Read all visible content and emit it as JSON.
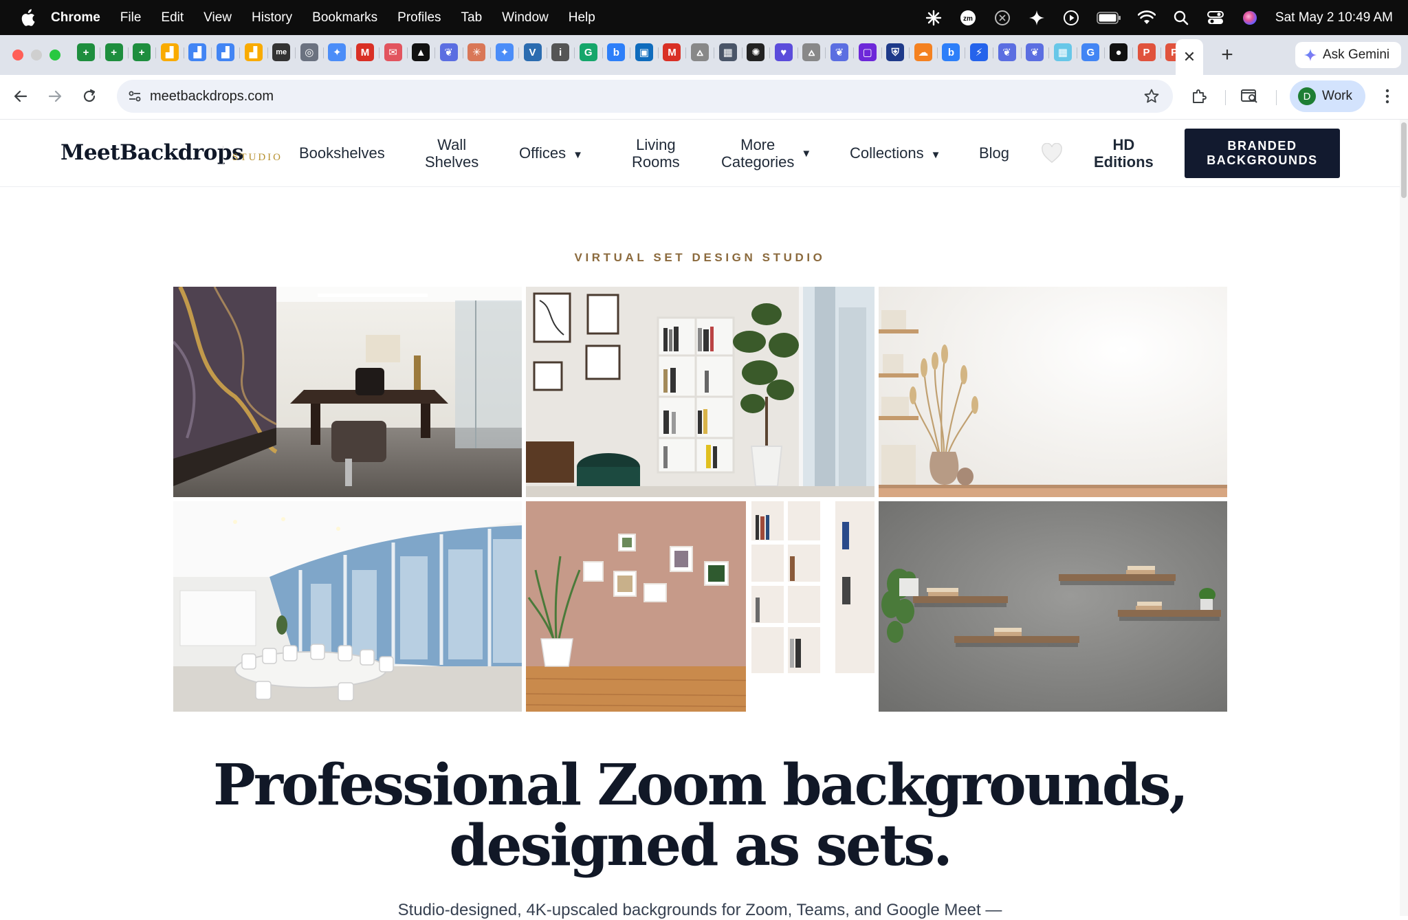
{
  "menubar": {
    "items": [
      "Chrome",
      "File",
      "Edit",
      "View",
      "History",
      "Bookmarks",
      "Profiles",
      "Tab",
      "Window",
      "Help"
    ],
    "datetime": "Sat May 2  10:49 AM"
  },
  "tabs": {
    "favicons": [
      {
        "icon": "sheets-icon",
        "color": "#1e8e3e",
        "glyph": "+"
      },
      {
        "icon": "sheets-icon",
        "color": "#1e8e3e",
        "glyph": "+"
      },
      {
        "icon": "sheets-icon",
        "color": "#1e8e3e",
        "glyph": "+"
      },
      {
        "icon": "analytics-icon",
        "color": "#f9ab00",
        "glyph": "▟"
      },
      {
        "icon": "analytics-icon",
        "color": "#4285f4",
        "glyph": "▟"
      },
      {
        "icon": "analytics-icon",
        "color": "#4285f4",
        "glyph": "▟"
      },
      {
        "icon": "analytics-icon",
        "color": "#f9ab00",
        "glyph": "▟"
      },
      {
        "icon": "meta-icon",
        "color": "#333333",
        "glyph": "me"
      },
      {
        "icon": "globe-icon",
        "color": "#6b7280",
        "glyph": "◎"
      },
      {
        "icon": "gemini-icon",
        "color": "#4b8df8",
        "glyph": "✦"
      },
      {
        "icon": "gmail-icon",
        "color": "#d93025",
        "glyph": "M"
      },
      {
        "icon": "mail-icon",
        "color": "#e2545e",
        "glyph": "✉"
      },
      {
        "icon": "triangle-icon",
        "color": "#111111",
        "glyph": "▲"
      },
      {
        "icon": "copilot-icon",
        "color": "#5b6ee1",
        "glyph": "❦"
      },
      {
        "icon": "claude-icon",
        "color": "#d97757",
        "glyph": "✳"
      },
      {
        "icon": "gemini-icon",
        "color": "#4b8df8",
        "glyph": "✦"
      },
      {
        "icon": "v-icon",
        "color": "#2b6cb0",
        "glyph": "V"
      },
      {
        "icon": "info-icon",
        "color": "#555555",
        "glyph": "i"
      },
      {
        "icon": "grammarly-icon",
        "color": "#15a66b",
        "glyph": "G"
      },
      {
        "icon": "bing-icon",
        "color": "#2d7ff9",
        "glyph": "b"
      },
      {
        "icon": "outlook-icon",
        "color": "#0f6cbd",
        "glyph": "▣"
      },
      {
        "icon": "gmail-icon",
        "color": "#d93025",
        "glyph": "M"
      },
      {
        "icon": "scholar-icon",
        "color": "#888888",
        "glyph": "⩟"
      },
      {
        "icon": "calculator-icon",
        "color": "#4a5568",
        "glyph": "▦"
      },
      {
        "icon": "openai-icon",
        "color": "#222222",
        "glyph": "✺"
      },
      {
        "icon": "chat-icon",
        "color": "#5b4cdb",
        "glyph": "♥"
      },
      {
        "icon": "scholar-icon",
        "color": "#888888",
        "glyph": "⩟"
      },
      {
        "icon": "copilot-icon",
        "color": "#5b6ee1",
        "glyph": "❦"
      },
      {
        "icon": "square-icon",
        "color": "#6d28d9",
        "glyph": "▢"
      },
      {
        "icon": "shield-icon",
        "color": "#1e3a8a",
        "glyph": "⛨"
      },
      {
        "icon": "cloudflare-icon",
        "color": "#f48120",
        "glyph": "☁"
      },
      {
        "icon": "bing-icon",
        "color": "#2d7ff9",
        "glyph": "b"
      },
      {
        "icon": "bolt-icon",
        "color": "#2563eb",
        "glyph": "⚡"
      },
      {
        "icon": "copilot-icon",
        "color": "#5b6ee1",
        "glyph": "❦"
      },
      {
        "icon": "copilot-icon",
        "color": "#5b6ee1",
        "glyph": "❦"
      },
      {
        "icon": "grid-icon",
        "color": "#67c7e8",
        "glyph": "▦"
      },
      {
        "icon": "google-icon",
        "color": "#4285f4",
        "glyph": "G"
      },
      {
        "icon": "github-icon",
        "color": "#111111",
        "glyph": "●"
      },
      {
        "icon": "pinterest-icon",
        "color": "#e0533d",
        "glyph": "P"
      },
      {
        "icon": "pinterest-icon",
        "color": "#e0533d",
        "glyph": "P"
      }
    ],
    "ask_gemini": "Ask Gemini"
  },
  "toolbar": {
    "url": "meetbackdrops.com",
    "profile_initial": "D",
    "profile_label": "Work"
  },
  "site": {
    "logo": "MeetBackdrops",
    "logo_sub": "STUDIO",
    "nav": {
      "bookshelves": "Bookshelves",
      "wall_shelves_1": "Wall",
      "wall_shelves_2": "Shelves",
      "offices": "Offices",
      "living_rooms_1": "Living",
      "living_rooms_2": "Rooms",
      "more_1": "More",
      "more_2": "Categories",
      "collections": "Collections",
      "blog": "Blog",
      "hd_1": "HD",
      "hd_2": "Editions",
      "cta_1": "BRANDED",
      "cta_2": "BACKGROUNDS"
    },
    "caret": "▼"
  },
  "hero": {
    "eyebrow": "VIRTUAL SET DESIGN STUDIO",
    "headline_line1": "Professional Zoom backgrounds,",
    "headline_line2": "designed as sets.",
    "subtext": "Studio-designed, 4K-upscaled backgrounds for Zoom, Teams, and Google Meet —"
  },
  "colors": {
    "accent_gold": "#b7912f",
    "eyebrow": "#8b6a3d",
    "cta_bg": "#121a2f",
    "headline": "#111827"
  }
}
